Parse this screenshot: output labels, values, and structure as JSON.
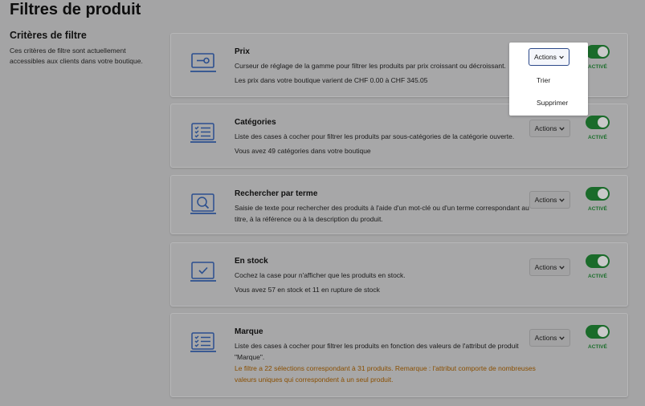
{
  "page": {
    "title": "Filtres de produit",
    "section_title": "Critères de filtre",
    "section_description": "Ces critères de filtre sont actuellement accessibles aux clients dans votre boutique."
  },
  "common": {
    "actions_label": "Actions",
    "active_label": "ACTIVÉ",
    "toggle_on_color": "#1a6b2a",
    "accent_color": "#2d4a8a"
  },
  "filters": [
    {
      "title": "Prix",
      "icon": "slider-icon",
      "description": "Curseur de réglage de la gamme pour filtrer les produits par prix croissant ou décroissant.",
      "info": "Les prix dans votre boutique varient de CHF 0.00 à CHF 345.05",
      "active": true
    },
    {
      "title": "Catégories",
      "icon": "checklist-icon",
      "description": "Liste des cases à cocher pour filtrer les produits par sous-catégories de la catégorie ouverte.",
      "info": "Vous avez 49 catégories dans votre boutique",
      "active": true
    },
    {
      "title": "Rechercher par terme",
      "icon": "search-icon",
      "description": "Saisie de texte pour rechercher des produits à l'aide d'un mot-clé ou d'un terme correspondant au titre, à la référence ou à la description du produit.",
      "info": "",
      "active": true
    },
    {
      "title": "En stock",
      "icon": "checkbox-icon",
      "description": "Cochez la case pour n'afficher que les produits en stock.",
      "info": "Vous avez 57 en stock et 11 en rupture de stock",
      "active": true
    },
    {
      "title": "Marque",
      "icon": "checklist-icon",
      "description": "Liste des cases à cocher pour filtrer les produits en fonction des valeurs de l'attribut de produit \"Marque\".",
      "warning": "Le filtre a 22 sélections correspondant à 31 produits. Remarque : l'attribut comporte de nombreuses valeurs uniques qui correspondent à un seul produit.",
      "active": true
    }
  ],
  "dropdown": {
    "items": [
      "Trier",
      "Supprimer"
    ]
  }
}
